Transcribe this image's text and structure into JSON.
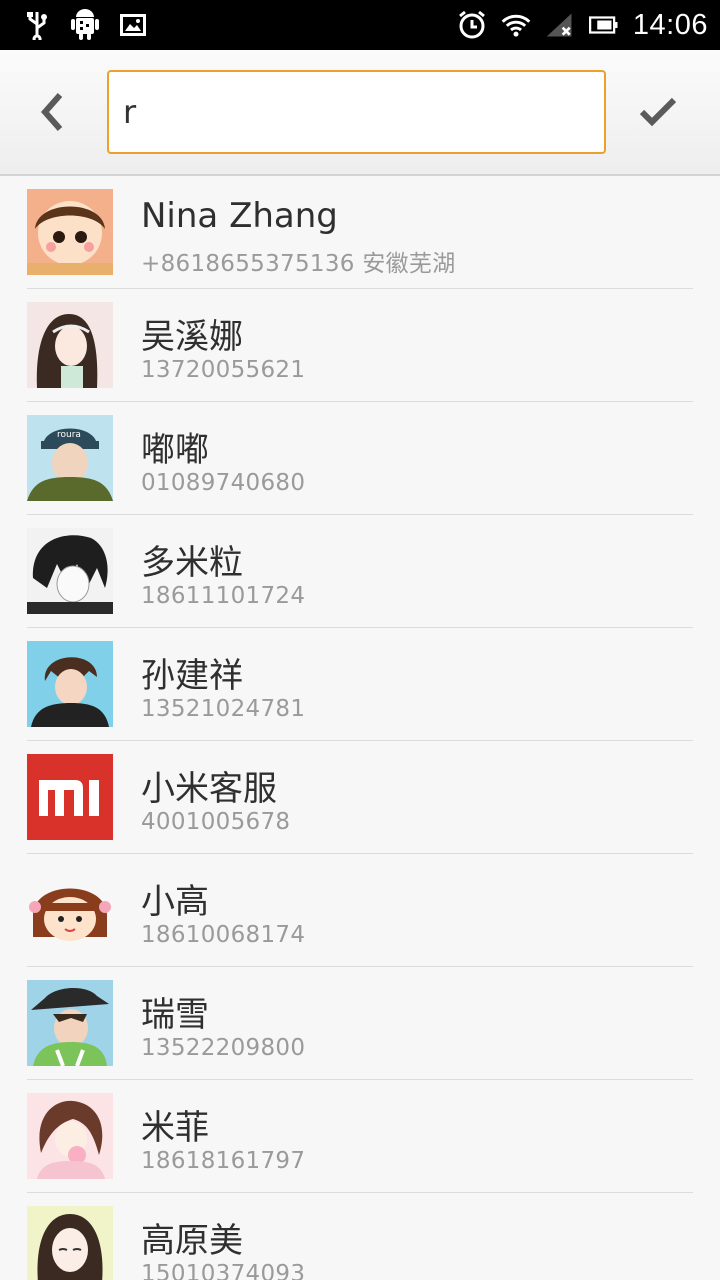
{
  "status_bar": {
    "time": "14:06",
    "icons": [
      "usb-icon",
      "android-debug-icon",
      "image-icon",
      "alarm-icon",
      "wifi-icon",
      "signal-off-icon",
      "battery-icon"
    ]
  },
  "search": {
    "query": "r",
    "back_icon": "chevron-left-icon",
    "confirm_icon": "checkmark-icon"
  },
  "colors": {
    "accent": "#eca12a",
    "name_text": "#2f2f2f",
    "detail_text": "#9a9a9a"
  },
  "contacts": [
    {
      "name": "Nina Zhang",
      "detail": "+8618655375136  安徽芜湖"
    },
    {
      "name": "吴溪娜",
      "detail": "13720055621"
    },
    {
      "name": "嘟嘟",
      "detail": "01089740680"
    },
    {
      "name": "多米粒",
      "detail": "18611101724"
    },
    {
      "name": "孙建祥",
      "detail": "13521024781"
    },
    {
      "name": "小米客服",
      "detail": "4001005678"
    },
    {
      "name": "小高",
      "detail": "18610068174"
    },
    {
      "name": "瑞雪",
      "detail": "13522209800"
    },
    {
      "name": "米菲",
      "detail": "18618161797"
    },
    {
      "name": "高原美",
      "detail": "15010374093"
    }
  ]
}
